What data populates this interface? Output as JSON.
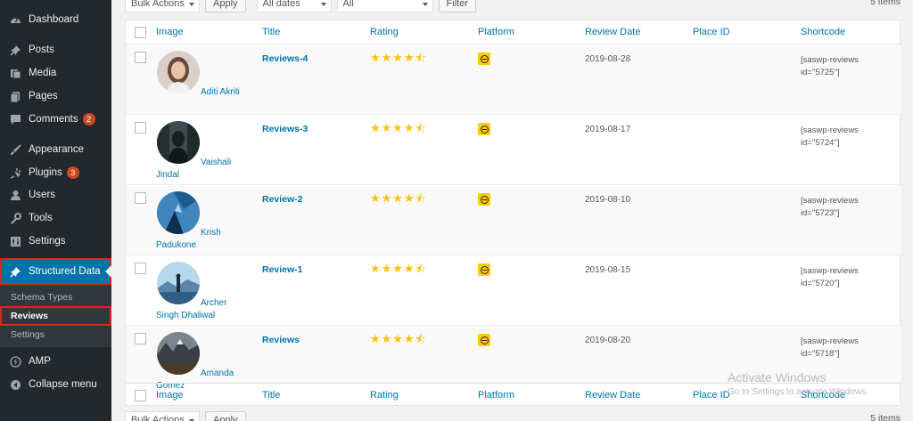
{
  "sidebar": {
    "items": [
      {
        "label": "Dashboard",
        "icon": "dashboard-icon"
      },
      {
        "label": "Posts",
        "icon": "pin-icon"
      },
      {
        "label": "Media",
        "icon": "media-icon"
      },
      {
        "label": "Pages",
        "icon": "pages-icon"
      },
      {
        "label": "Comments",
        "icon": "comment-icon",
        "badge": "2"
      },
      {
        "label": "Appearance",
        "icon": "brush-icon"
      },
      {
        "label": "Plugins",
        "icon": "plugin-icon",
        "badge": "3"
      },
      {
        "label": "Users",
        "icon": "user-icon"
      },
      {
        "label": "Tools",
        "icon": "wrench-icon"
      },
      {
        "label": "Settings",
        "icon": "settings-icon"
      },
      {
        "label": "Structured Data",
        "icon": "pin-icon"
      },
      {
        "label": "AMP",
        "icon": "amp-icon"
      },
      {
        "label": "Collapse menu",
        "icon": "collapse-icon"
      }
    ],
    "submenu": [
      "Schema Types",
      "Reviews",
      "Settings"
    ]
  },
  "toolbar": {
    "bulk_actions": "Bulk Actions",
    "apply": "Apply",
    "dates": "All dates",
    "all": "All",
    "filter": "Filter",
    "items_count": "5 items"
  },
  "table": {
    "headers": [
      "Image",
      "Title",
      "Rating",
      "Platform",
      "Review Date",
      "Place ID",
      "Shortcode"
    ],
    "rows": [
      {
        "name": "Aditi Akriti",
        "title": "Reviews-4",
        "date": "2019-08-28",
        "shortcode": "[saswp-reviews id=\"5725\"]"
      },
      {
        "name": "Vaishali Jindal",
        "title": "Reviews-3",
        "date": "2019-08-17",
        "shortcode": "[saswp-reviews id=\"5724\"]"
      },
      {
        "name": "Krish Padukone",
        "title": "Review-2",
        "date": "2019-08-10",
        "shortcode": "[saswp-reviews id=\"5723\"]"
      },
      {
        "name": "Archer Singh Dhaliwal",
        "title": "Review-1",
        "date": "2019-08-15",
        "shortcode": "[saswp-reviews id=\"5720\"]"
      },
      {
        "name": "Amanda Gomez",
        "title": "Reviews",
        "date": "2019-08-20",
        "shortcode": "[saswp-reviews id=\"5718\"]"
      }
    ],
    "rating_stars": "★★★★⯪"
  },
  "watermark": {
    "line1": "Activate Windows",
    "line2": "Go to Settings to activate Windows."
  },
  "colors": {
    "sidebar_bg": "#23282d",
    "active_blue": "#0073aa",
    "highlight_red": "#e0231f",
    "star_yellow": "#ffc107",
    "badge_orange": "#ca4a1f"
  }
}
